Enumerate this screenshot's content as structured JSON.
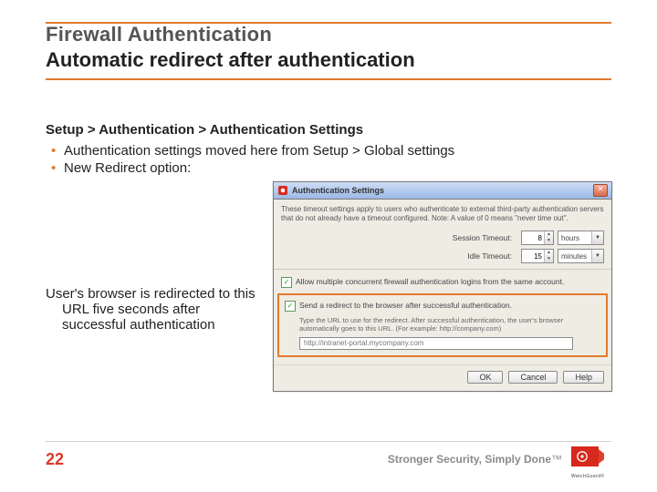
{
  "title": {
    "line1": "Firewall Authentication",
    "line2": "Automatic redirect after authentication"
  },
  "breadcrumb": "Setup > Authentication > Authentication Settings",
  "bullets": [
    "Authentication settings moved here from Setup > Global settings",
    "New Redirect option:"
  ],
  "caption": "User's browser is redirected to this URL five seconds after successful authentication",
  "dialog": {
    "title": "Authentication Settings",
    "close_glyph": "✕",
    "description": "These timeout settings apply to users who authenticate to external third-party authentication servers that do not already have a timeout configured. Note: A value of 0 means \"never time out\".",
    "session_timeout": {
      "label": "Session Timeout:",
      "value": "8",
      "unit": "hours"
    },
    "idle_timeout": {
      "label": "Idle Timeout:",
      "value": "15",
      "unit": "minutes"
    },
    "allow_multiple_label": "Allow multiple concurrent firewall authentication logins from the same account.",
    "redirect": {
      "checkbox_label": "Send a redirect to the browser after successful authentication.",
      "description": "Type the URL to use for the redirect. After successful authentication, the user's browser automatically goes to this URL. (For example: http://company.com)",
      "placeholder": "http://intranet-portal.mycompany.com"
    },
    "buttons": {
      "ok": "OK",
      "cancel": "Cancel",
      "help": "Help"
    }
  },
  "footer": {
    "page": "22",
    "tagline_strong": "Stronger Security, Simply Done",
    "tagline_tm": "™",
    "brand": "WatchGuard",
    "brand_reg": "®"
  }
}
